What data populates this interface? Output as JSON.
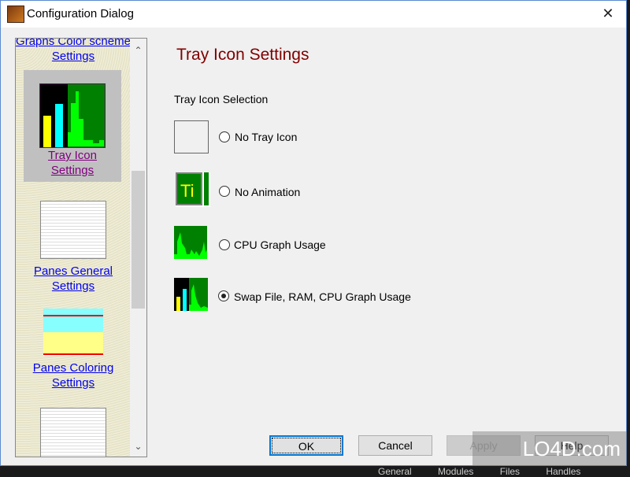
{
  "window": {
    "title": "Configuration Dialog",
    "close_label": "✕"
  },
  "sidebar": {
    "items": [
      {
        "label": "Graphs Color scheme Settings",
        "selected": false
      },
      {
        "label": "Tray Icon Settings",
        "selected": true
      },
      {
        "label": "Panes General Settings",
        "selected": false
      },
      {
        "label": "Panes Coloring Settings",
        "selected": false
      }
    ],
    "scroll_up": "⌃",
    "scroll_down": "⌄"
  },
  "main": {
    "heading": "Tray Icon Settings",
    "group_label": "Tray Icon Selection",
    "options": [
      {
        "label": "No Tray Icon",
        "checked": false,
        "icon": "empty-icon"
      },
      {
        "label": "No Animation",
        "checked": false,
        "icon": "ti-text-icon"
      },
      {
        "label": "CPU Graph Usage",
        "checked": false,
        "icon": "cpu-graph-icon"
      },
      {
        "label": "Swap File, RAM, CPU Graph Usage",
        "checked": true,
        "icon": "swap-ram-cpu-graph-icon"
      }
    ]
  },
  "buttons": {
    "ok": "OK",
    "cancel": "Cancel",
    "apply": "Apply",
    "help": "Help"
  },
  "watermark": "LO4D.com",
  "background_tabs": "General Modules Files Handles",
  "colors": {
    "heading": "#800000",
    "link": "#0000ee",
    "visited_link": "#800080",
    "graph_green": "#008000",
    "bright_green": "#00ff00",
    "yellow": "#ffff00",
    "cyan": "#00ffff"
  }
}
